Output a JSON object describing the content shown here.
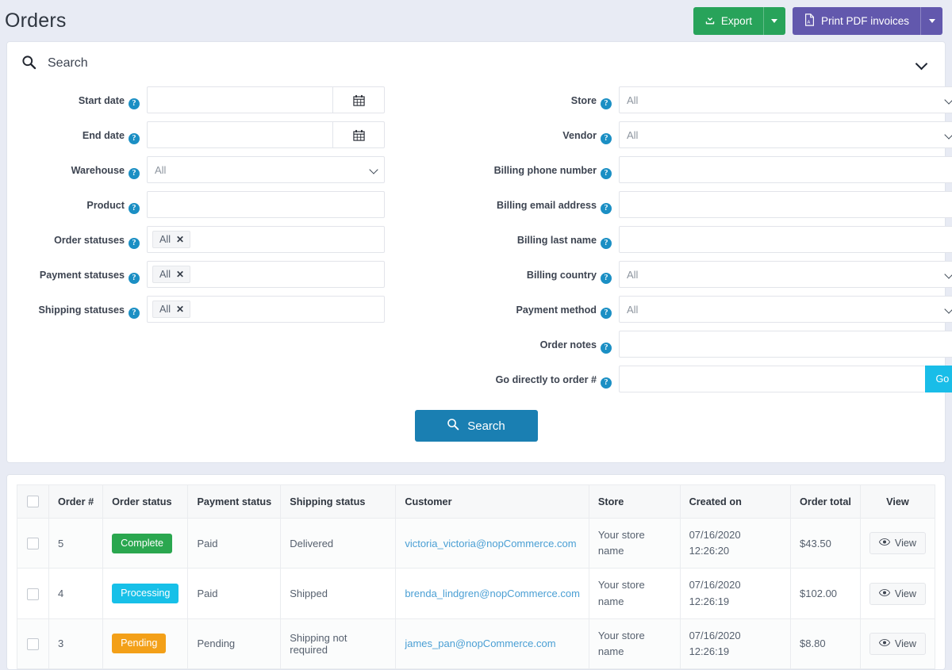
{
  "header": {
    "title": "Orders",
    "export_label": "Export",
    "export_color": "#28a35a",
    "pdf_label": "Print PDF invoices",
    "pdf_color": "#6258ad"
  },
  "search_panel": {
    "title": "Search",
    "submit_label": "Search",
    "submit_color": "#1a7fb2",
    "help_glyph": "?",
    "left_fields": [
      {
        "label": "Start date",
        "type": "date",
        "value": "",
        "placeholder": ""
      },
      {
        "label": "End date",
        "type": "date",
        "value": "",
        "placeholder": ""
      },
      {
        "label": "Warehouse",
        "type": "select",
        "value": "All"
      },
      {
        "label": "Product",
        "type": "text",
        "value": "",
        "placeholder": ""
      },
      {
        "label": "Order statuses",
        "type": "tags",
        "tags": [
          "All"
        ]
      },
      {
        "label": "Payment statuses",
        "type": "tags",
        "tags": [
          "All"
        ]
      },
      {
        "label": "Shipping statuses",
        "type": "tags",
        "tags": [
          "All"
        ]
      }
    ],
    "right_fields": [
      {
        "label": "Store",
        "type": "select",
        "value": "All"
      },
      {
        "label": "Vendor",
        "type": "select",
        "value": "All"
      },
      {
        "label": "Billing phone number",
        "type": "text",
        "value": "",
        "placeholder": ""
      },
      {
        "label": "Billing email address",
        "type": "text",
        "value": "",
        "placeholder": ""
      },
      {
        "label": "Billing last name",
        "type": "text",
        "value": "",
        "placeholder": ""
      },
      {
        "label": "Billing country",
        "type": "select",
        "value": "All"
      },
      {
        "label": "Payment method",
        "type": "select",
        "value": "All"
      },
      {
        "label": "Order notes",
        "type": "text",
        "value": "",
        "placeholder": ""
      },
      {
        "label": "Go directly to order #",
        "type": "go",
        "value": "",
        "placeholder": "",
        "button_label": "Go",
        "button_color": "#19bde8"
      }
    ],
    "tag_remove_glyph": "✕"
  },
  "grid": {
    "select_all": false,
    "columns": [
      "Order #",
      "Order status",
      "Payment status",
      "Shipping status",
      "Customer",
      "Store",
      "Created on",
      "Order total",
      "View"
    ],
    "view_label": "View",
    "rows": [
      {
        "selected": false,
        "order_number": "5",
        "order_status": "Complete",
        "order_status_color": "#2aa74f",
        "payment_status": "Paid",
        "shipping_status": "Delivered",
        "customer": "victoria_victoria@nopCommerce.com",
        "store": "Your store name",
        "created_on": "07/16/2020 12:26:20",
        "order_total": "$43.50",
        "view_label": "View"
      },
      {
        "selected": false,
        "order_number": "4",
        "order_status": "Processing",
        "order_status_color": "#17c0e8",
        "payment_status": "Paid",
        "shipping_status": "Shipped",
        "customer": "brenda_lindgren@nopCommerce.com",
        "store": "Your store name",
        "created_on": "07/16/2020 12:26:19",
        "order_total": "$102.00",
        "view_label": "View"
      },
      {
        "selected": false,
        "order_number": "3",
        "order_status": "Pending",
        "order_status_color": "#f3a018",
        "payment_status": "Pending",
        "shipping_status": "Shipping not required",
        "customer": "james_pan@nopCommerce.com",
        "store": "Your store name",
        "created_on": "07/16/2020 12:26:19",
        "order_total": "$8.80",
        "view_label": "View"
      }
    ]
  }
}
